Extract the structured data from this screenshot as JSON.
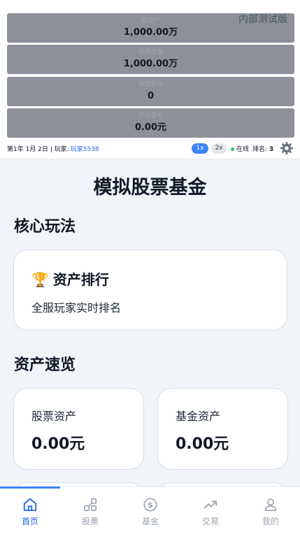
{
  "header": {
    "test_tag": "内部测试版",
    "stats": [
      {
        "label": "总资产",
        "value": "1,000.00万"
      },
      {
        "label": "可用资金",
        "value": "1,000.00万"
      },
      {
        "label": "游戏积分",
        "value": "0"
      },
      {
        "label": "今日盈亏",
        "value": "0.00元"
      }
    ],
    "date": "第1年 1月 2日 | 玩家:",
    "player": "玩家5538",
    "speed_1x": "1x",
    "speed_2x": "2x",
    "online": "在线",
    "rank_label": "排名:",
    "rank_value": "3",
    "colors": {
      "accent": "#3b82f6",
      "online": "#22c55e",
      "stat_bg": "#8d9099"
    }
  },
  "main": {
    "title": "模拟股票基金",
    "core_section": "核心玩法",
    "rank_card": {
      "icon": "trophy-icon",
      "title": "资产排行",
      "desc": "全服玩家实时排名"
    },
    "overview_section": "资产速览",
    "assets": [
      {
        "label": "股票资产",
        "value": "0.00元"
      },
      {
        "label": "基金资产",
        "value": "0.00元"
      }
    ]
  },
  "nav": {
    "items": [
      {
        "label": "首页",
        "icon": "home-icon",
        "active": true
      },
      {
        "label": "股票",
        "icon": "stock-icon",
        "active": false
      },
      {
        "label": "基金",
        "icon": "fund-icon",
        "active": false
      },
      {
        "label": "交易",
        "icon": "trend-icon",
        "active": false
      },
      {
        "label": "我的",
        "icon": "user-icon",
        "active": false
      }
    ]
  }
}
